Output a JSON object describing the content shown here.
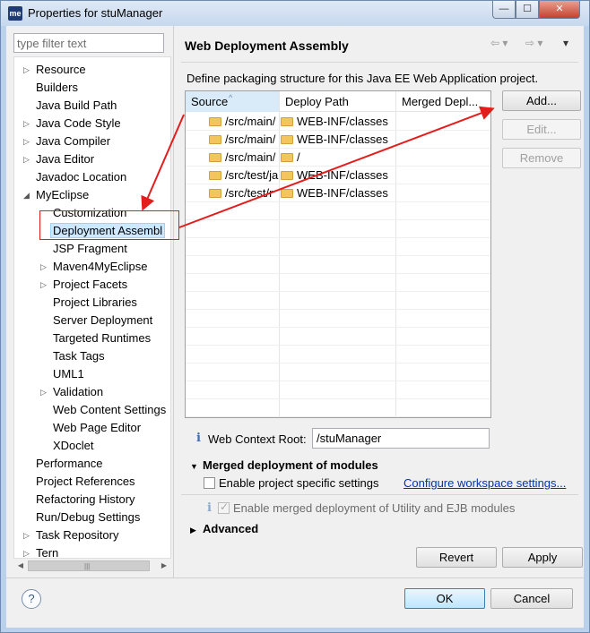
{
  "window": {
    "title": "Properties for stuManager",
    "app_icon_text": "me",
    "minimize_glyph": "—",
    "maximize_glyph": "☐",
    "close_glyph": "✕"
  },
  "filter": {
    "placeholder": "type filter text"
  },
  "tree": {
    "items": [
      {
        "label": "Resource",
        "twisty": "▷"
      },
      {
        "label": "Builders"
      },
      {
        "label": "Java Build Path"
      },
      {
        "label": "Java Code Style",
        "twisty": "▷"
      },
      {
        "label": "Java Compiler",
        "twisty": "▷"
      },
      {
        "label": "Java Editor",
        "twisty": "▷"
      },
      {
        "label": "Javadoc Location"
      },
      {
        "label": "MyEclipse",
        "twisty": "◢"
      },
      {
        "label": "Customization"
      },
      {
        "label": "Deployment Assembl",
        "selected": true
      },
      {
        "label": "JSP Fragment"
      },
      {
        "label": "Maven4MyEclipse",
        "twisty": "▷"
      },
      {
        "label": "Project Facets",
        "twisty": "▷"
      },
      {
        "label": "Project Libraries"
      },
      {
        "label": "Server Deployment"
      },
      {
        "label": "Targeted Runtimes"
      },
      {
        "label": "Task Tags"
      },
      {
        "label": "UML1"
      },
      {
        "label": "Validation",
        "twisty": "▷"
      },
      {
        "label": "Web Content Settings"
      },
      {
        "label": "Web Page Editor"
      },
      {
        "label": "XDoclet"
      },
      {
        "label": "Performance"
      },
      {
        "label": "Project References"
      },
      {
        "label": "Refactoring History"
      },
      {
        "label": "Run/Debug Settings"
      },
      {
        "label": "Task Repository",
        "twisty": "▷"
      },
      {
        "label": "Tern",
        "twisty": "▷"
      }
    ],
    "scroll_left": "◀",
    "scroll_right": "▶",
    "scroll_grip": "|||"
  },
  "page": {
    "title": "Web Deployment Assembly",
    "nav_back": "⇦ ▾",
    "nav_forward": "⇨ ▾",
    "nav_menu": "▾",
    "description": "Define packaging structure for this Java EE Web Application project."
  },
  "table": {
    "columns": [
      "Source",
      "Deploy Path",
      "Merged Depl..."
    ],
    "sort_glyph": "^",
    "rows": [
      {
        "source": "/src/main/",
        "deploy": "WEB-INF/classes"
      },
      {
        "source": "/src/main/",
        "deploy": "WEB-INF/classes"
      },
      {
        "source": "/src/main/",
        "deploy": "/"
      },
      {
        "source": "/src/test/ja",
        "deploy": "WEB-INF/classes"
      },
      {
        "source": "/src/test/r",
        "deploy": "WEB-INF/classes"
      }
    ]
  },
  "buttons": {
    "add": "Add...",
    "edit": "Edit...",
    "remove": "Remove",
    "revert": "Revert",
    "apply": "Apply",
    "ok": "OK",
    "cancel": "Cancel"
  },
  "context_root": {
    "info_glyph": "i",
    "label": "Web Context Root:",
    "value": "/stuManager"
  },
  "merged": {
    "expanded_glyph": "▼",
    "title": "Merged deployment of modules",
    "project_specific_label": "Enable project specific settings",
    "configure_link": "Configure workspace settings...",
    "info_glyph": "i",
    "check_glyph": "✓",
    "enable_merged_label": "Enable merged deployment of Utility and EJB modules"
  },
  "advanced": {
    "collapsed_glyph": "▶",
    "title": "Advanced"
  },
  "help": {
    "glyph": "?"
  },
  "annotation": {
    "color": "#e31c1c"
  }
}
